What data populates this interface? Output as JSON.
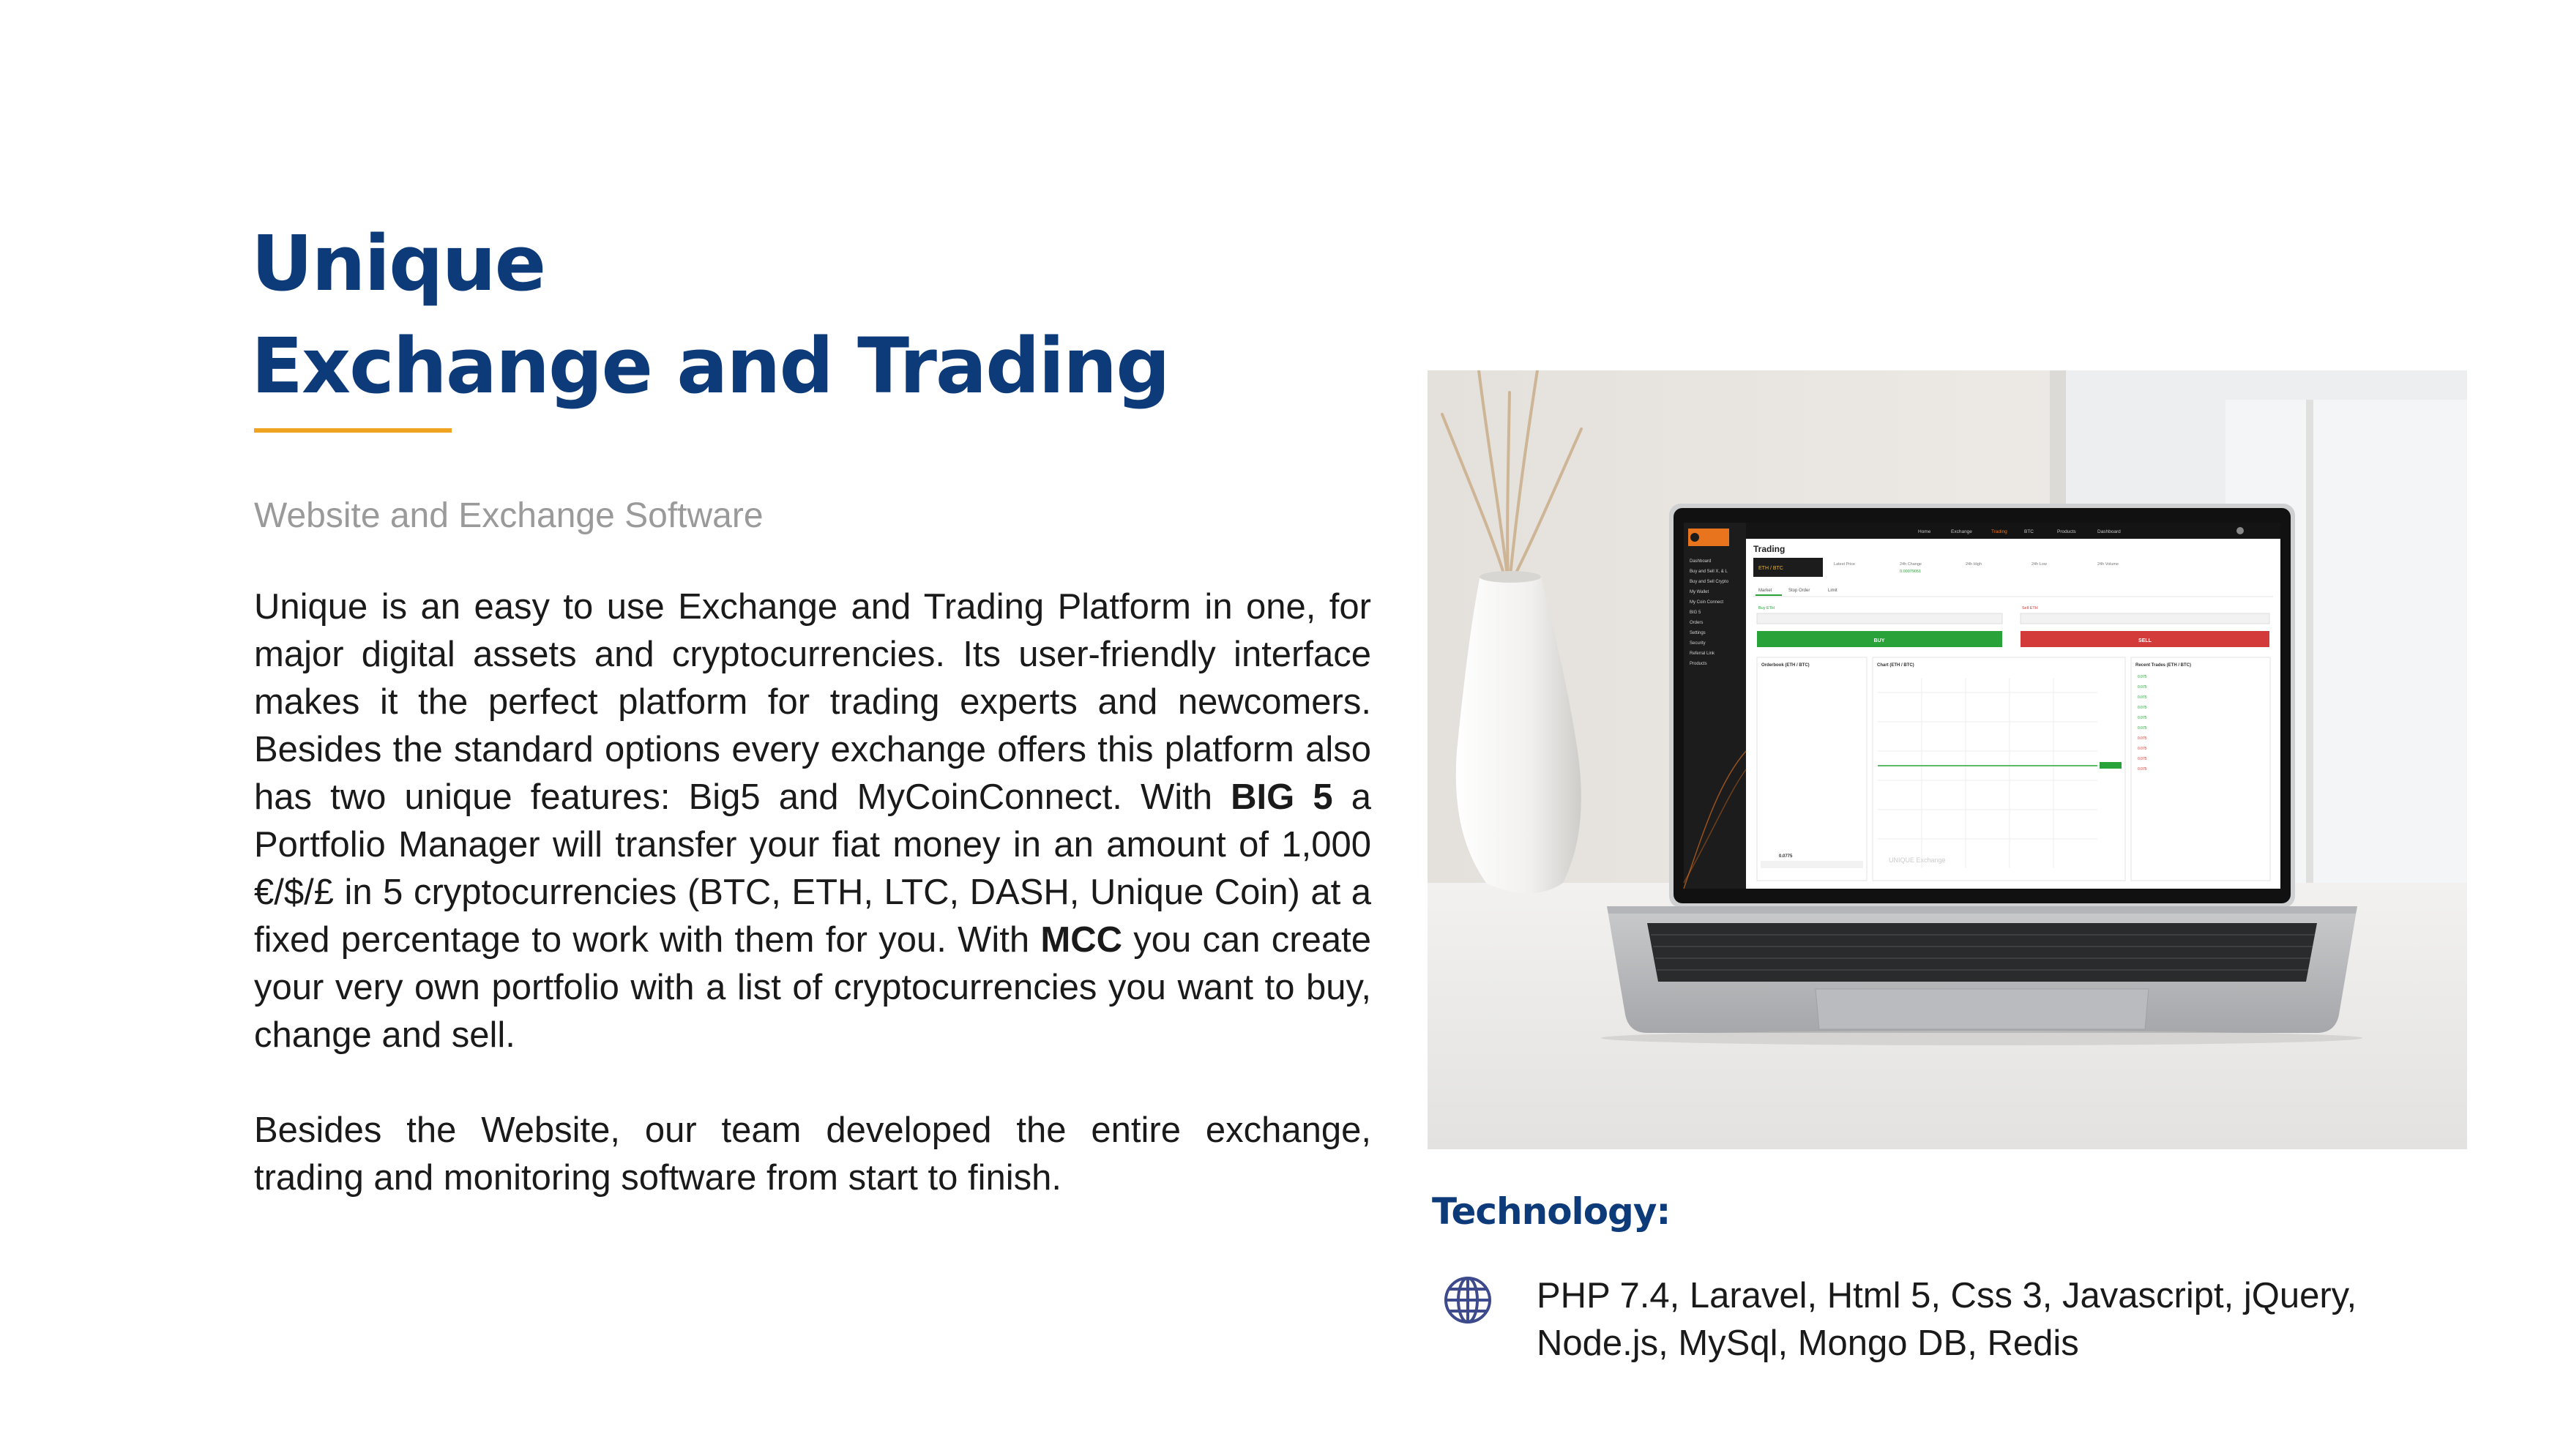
{
  "header": {
    "title_line1": "Unique",
    "title_line2": "Exchange and Trading",
    "subtitle": "Website and Exchange Software"
  },
  "description": {
    "para1_a": "Unique is an easy to use Exchange and Trading Platform in one, for major digital assets and cryptocurrencies. Its user-friendly interface makes it the perfect platform for trading experts and newcomers. Besides the standard options every exchange offers this platform also has two unique features: Big5 and MyCoinConnect. With ",
    "big5": "BIG 5",
    "para1_b": " a Portfolio Manager will transfer your fiat money in an amount of 1,000 €/$/£ in 5 cryptocurrencies (BTC, ETH, LTC, DASH, Unique Coin) at a fixed percentage to work with them for you. With ",
    "mcc": "MCC",
    "para1_c": " you can create your very own portfolio with a list of cryptocurrencies you want to buy, change and sell.",
    "para2": "Besides the Website, our team developed the entire exchange, trading and monitoring software from start to finish."
  },
  "laptop_screen": {
    "page_heading": "Trading",
    "nav_items": [
      "Home",
      "Exchange",
      "Trading",
      "BTC",
      "Products",
      "Dashboard"
    ],
    "sidebar_items": [
      "Dashboard",
      "Buy and Sell X, & L",
      "Buy and Sell Crypto",
      "My Wallet",
      "My Coin Connect",
      "BIG 5",
      "Orders",
      "Settings",
      "Security",
      "Referral Link",
      "Products"
    ],
    "pair": "ETH / BTC",
    "tabs": [
      "Market",
      "Stop Order",
      "Limit"
    ],
    "buy_label": "BUY",
    "sell_label": "SELL",
    "panels": [
      "Orderbook (ETH / BTC)",
      "Chart (ETH / BTC)",
      "Recent Trades (ETH / BTC)"
    ],
    "watermark": "UNIQUE Exchange",
    "colors": {
      "sidebar": "#1c1c1c",
      "topbar": "#141414",
      "buy": "#2aa23a",
      "sell": "#d33a3a",
      "brand_orange": "#e8741e"
    }
  },
  "technology": {
    "heading": "Technology:",
    "icon": "globe-icon",
    "list": "PHP 7.4, Laravel, Html 5, Css 3, Javascript, jQuery, Node.js, MySql, Mongo DB, Redis"
  },
  "colors": {
    "title": "#0d3b7a",
    "accent_rule": "#f0a321",
    "subtitle": "#9a9a9a",
    "body": "#1a1a1a"
  }
}
